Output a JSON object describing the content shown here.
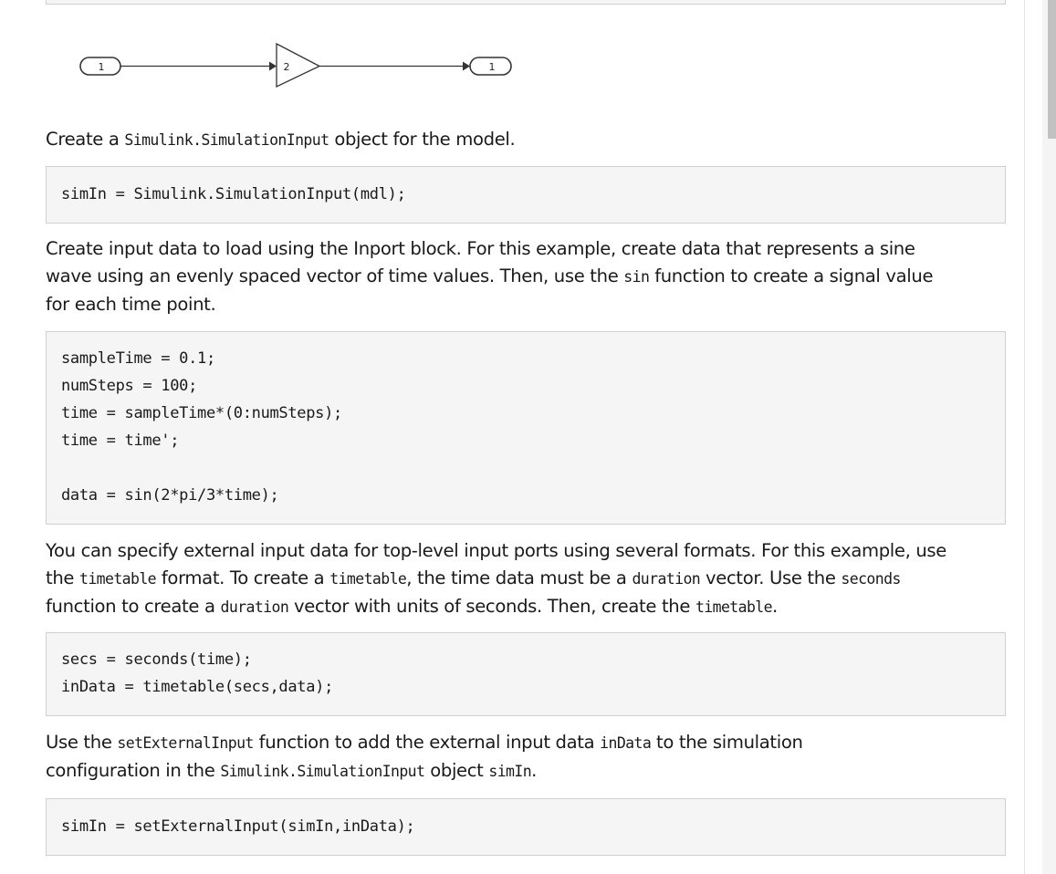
{
  "diagram": {
    "inport_label": "1",
    "gain_label": "2",
    "outport_label": "1"
  },
  "paragraphs": {
    "p1": {
      "t1": "Create a ",
      "c1": "Simulink.SimulationInput",
      "t2": " object for the model."
    },
    "p2": {
      "l1": "Create input data to load using the Inport block. For this example, create data that represents a sine",
      "l2_t1": "wave using an evenly spaced vector of time values. Then, use the ",
      "l2_c1": "sin",
      "l2_t2": " function to create a signal value",
      "l3": "for each time point."
    },
    "p3": {
      "l1": "You can specify external input data for top-level input ports using several formats. For this example, use",
      "l2_t1": "the ",
      "l2_c1": "timetable",
      "l2_t2": " format. To create a ",
      "l2_c2": "timetable",
      "l2_t3": ", the time data must be a ",
      "l2_c3": "duration",
      "l2_t4": " vector. Use the ",
      "l2_c4": "seconds",
      "l3_t1": "function to create a ",
      "l3_c1": "duration",
      "l3_t2": " vector with units of seconds. Then, create the ",
      "l3_c2": "timetable",
      "l3_t3": "."
    },
    "p4": {
      "l1_t1": "Use the ",
      "l1_c1": "setExternalInput",
      "l1_t2": " function to add the external input data ",
      "l1_c2": "inData",
      "l1_t3": " to the simulation",
      "l2_t1": "configuration in the ",
      "l2_c1": "Simulink.SimulationInput",
      "l2_t2": " object ",
      "l2_c2": "simIn",
      "l2_t3": "."
    }
  },
  "code": {
    "block1": [
      "simIn = Simulink.SimulationInput(mdl);"
    ],
    "block2": [
      "sampleTime = 0.1;",
      "numSteps = 100;",
      "time = sampleTime*(0:numSteps);",
      "time = time';",
      "",
      "data = sin(2*pi/3*time);"
    ],
    "block3": [
      "secs = seconds(time);",
      "inData = timetable(secs,data);"
    ],
    "block4": [
      "simIn = setExternalInput(simIn,inData);"
    ]
  }
}
